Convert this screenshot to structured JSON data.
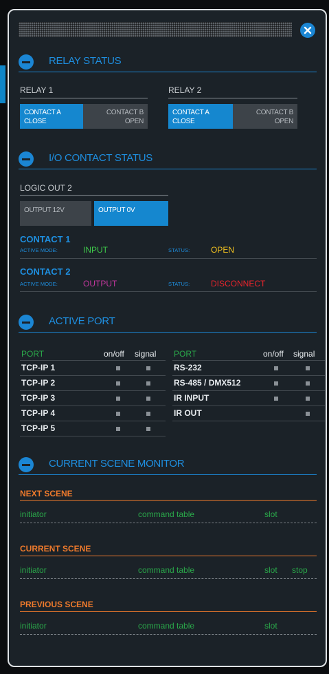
{
  "relay_status": {
    "title": "RELAY STATUS",
    "relay1": {
      "label": "RELAY 1",
      "contact_a": [
        "CONTACT A",
        "CLOSE"
      ],
      "contact_b": [
        "CONTACT B",
        "OPEN"
      ],
      "active": "a"
    },
    "relay2": {
      "label": "RELAY 2",
      "contact_a": [
        "CONTACT A",
        "CLOSE"
      ],
      "contact_b": [
        "CONTACT B",
        "OPEN"
      ],
      "active": "a"
    }
  },
  "io_status": {
    "title": "I/O CONTACT STATUS",
    "logic_out": {
      "label": "LOGIC OUT 2",
      "output_12v": "OUTPUT 12V",
      "output_0v": "OUTPUT 0V",
      "active": "0v"
    },
    "contact1": {
      "title": "CONTACT 1",
      "mode_label": "ACTIVE MODE:",
      "mode": "INPUT",
      "status_label": "STATUS:",
      "status": "OPEN"
    },
    "contact2": {
      "title": "CONTACT 2",
      "mode_label": "ACTIVE MODE:",
      "mode": "OUTPUT",
      "status_label": "STATUS:",
      "status": "DISCONNECT"
    }
  },
  "active_port": {
    "title": "ACTIVE PORT",
    "headers": {
      "port": "PORT",
      "onoff": "on/off",
      "signal": "signal"
    },
    "left_ports": [
      "TCP-IP 1",
      "TCP-IP 2",
      "TCP-IP 3",
      "TCP-IP 4",
      "TCP-IP 5"
    ],
    "right_ports": [
      "RS-232",
      "RS-485 / DMX512",
      "IR INPUT",
      "IR OUT"
    ]
  },
  "scene_monitor": {
    "title": "CURRENT SCENE MONITOR",
    "next": {
      "title": "NEXT SCENE",
      "initiator": "initiator",
      "command_table": "command table",
      "slot": "slot"
    },
    "current": {
      "title": "CURRENT SCENE",
      "initiator": "initiator",
      "command_table": "command table",
      "slot": "slot",
      "stop": "stop"
    },
    "previous": {
      "title": "PREVIOUS SCENE",
      "initiator": "initiator",
      "command_table": "command table",
      "slot": "slot"
    }
  },
  "colors": {
    "accent_blue": "#1e8fe0",
    "input_green": "#3ec94a",
    "open_yellow": "#f0c020",
    "output_magenta": "#c0379c",
    "disconnect_red": "#e8242c",
    "scene_orange": "#ee7a2c"
  }
}
